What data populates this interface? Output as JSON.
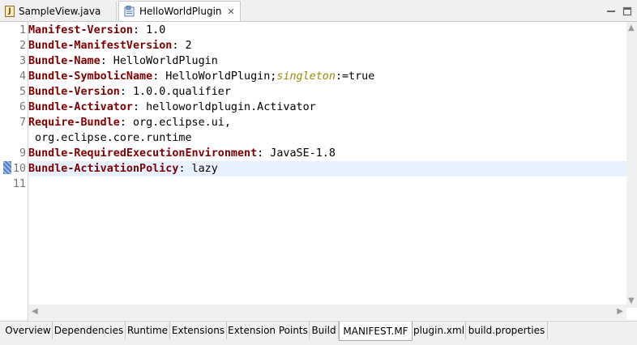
{
  "tabs": [
    {
      "label": "SampleView.java",
      "icon": "java-file-icon"
    },
    {
      "label": "HelloWorldPlugin",
      "icon": "plugin-manifest-icon",
      "closable": true,
      "active": true
    }
  ],
  "editor": {
    "current_line": 10,
    "lines": [
      {
        "num": "1",
        "key": "Manifest-Version",
        "sep": ":",
        "value": " 1.0"
      },
      {
        "num": "2",
        "key": "Bundle-ManifestVersion",
        "sep": ":",
        "value": " 2"
      },
      {
        "num": "3",
        "key": "Bundle-Name",
        "sep": ":",
        "value": " HelloWorldPlugin"
      },
      {
        "num": "4",
        "key": "Bundle-SymbolicName",
        "sep": ":",
        "value": " HelloWorldPlugin;",
        "attr": "singleton",
        "attr_value": ":=true"
      },
      {
        "num": "5",
        "key": "Bundle-Version",
        "sep": ":",
        "value": " 1.0.0.qualifier"
      },
      {
        "num": "6",
        "key": "Bundle-Activator",
        "sep": ":",
        "value": " helloworldplugin.Activator"
      },
      {
        "num": "7",
        "key": "Require-Bundle",
        "sep": ":",
        "value": " org.eclipse.ui,"
      },
      {
        "num": "",
        "key": "",
        "sep": "",
        "value": " org.eclipse.core.runtime"
      },
      {
        "num": "9",
        "key": "Bundle-RequiredExecutionEnvironment",
        "sep": ":",
        "value": " JavaSE-1.8"
      },
      {
        "num": "10",
        "key": "Bundle-ActivationPolicy",
        "sep": ":",
        "value": " lazy"
      },
      {
        "num": "11",
        "key": "",
        "sep": "",
        "value": ""
      }
    ]
  },
  "bottom_tabs": [
    {
      "label": "Overview"
    },
    {
      "label": "Dependencies"
    },
    {
      "label": "Runtime"
    },
    {
      "label": "Extensions"
    },
    {
      "label": "Extension Points"
    },
    {
      "label": "Build"
    },
    {
      "label": "MANIFEST.MF",
      "active": true
    },
    {
      "label": "plugin.xml"
    },
    {
      "label": "build.properties"
    }
  ],
  "colors": {
    "keyword": "#7f0000",
    "attribute": "#9b8a00",
    "current_line_bg": "#e8f2fe",
    "line_number": "#787878"
  }
}
